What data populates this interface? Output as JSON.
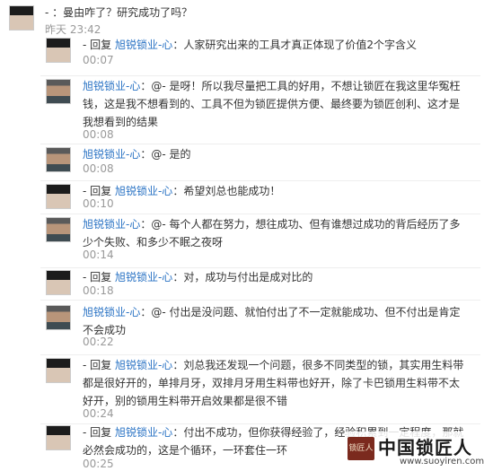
{
  "post": {
    "text": "- ：曼由咋了？研究成功了吗？",
    "time": "昨天 23:42"
  },
  "replies": [
    {
      "prefix": "- 回复 ",
      "name": "旭锐锁业-心",
      "content": "：人家研究出来的工具才真正体现了价值2个字含义",
      "time": "00:07",
      "avatar": "female-avatar"
    },
    {
      "prefix": "",
      "name": "旭锐锁业-心",
      "content": "：@- 是呀！所以我尽量把工具的好用，不想让锁匠在我这里华冤枉钱，这是我不想看到的、工具不但为锁匠提供方便、最终要为锁匠创利、这才是我想看到的结果",
      "time": "00:08",
      "avatar": "male-avatar"
    },
    {
      "prefix": "",
      "name": "旭锐锁业-心",
      "content": "：@- 是的",
      "time": "00:08",
      "avatar": "male-avatar"
    },
    {
      "prefix": "- 回复 ",
      "name": "旭锐锁业-心",
      "content": "：希望刘总也能成功！",
      "time": "00:10",
      "avatar": "female-avatar"
    },
    {
      "prefix": "",
      "name": "旭锐锁业-心",
      "content": "：@- 每个人都在努力，想往成功、但有谁想过成功的背后经历了多少个失败、和多少不眠之夜呀",
      "time": "00:14",
      "avatar": "male-avatar"
    },
    {
      "prefix": "- 回复 ",
      "name": "旭锐锁业-心",
      "content": "：对，成功与付出是成对比的",
      "time": "00:18",
      "avatar": "female-avatar"
    },
    {
      "prefix": "",
      "name": "旭锐锁业-心",
      "content": "：@- 付出是没问题、就怕付出了不一定就能成功、但不付出是肯定不会成功",
      "time": "00:22",
      "avatar": "male-avatar"
    },
    {
      "prefix": "- 回复 ",
      "name": "旭锐锁业-心",
      "content": "：刘总我还发现一个问题，很多不同类型的锁，其实用生料带都是很好开的，单排月牙，双排月牙用生料带也好开，除了卡巴锁用生料带不太好开，别的锁用生料带开启效果都是很不错",
      "time": "00:24",
      "avatar": "female-avatar"
    },
    {
      "prefix": "- 回复 ",
      "name": "旭锐锁业-心",
      "content": "：付出不成功，但你获得经验了，经验积累到一定程度，那就必然会成功的，这是个循环，一环套住一环",
      "time": "00:25",
      "avatar": "female-avatar"
    }
  ],
  "watermark": {
    "seal": "锁匠人",
    "title": "中国锁匠人",
    "url": "www.suoyiren.com"
  },
  "colors": {
    "name": "#2a73c4",
    "time": "#999999",
    "text": "#333333"
  }
}
